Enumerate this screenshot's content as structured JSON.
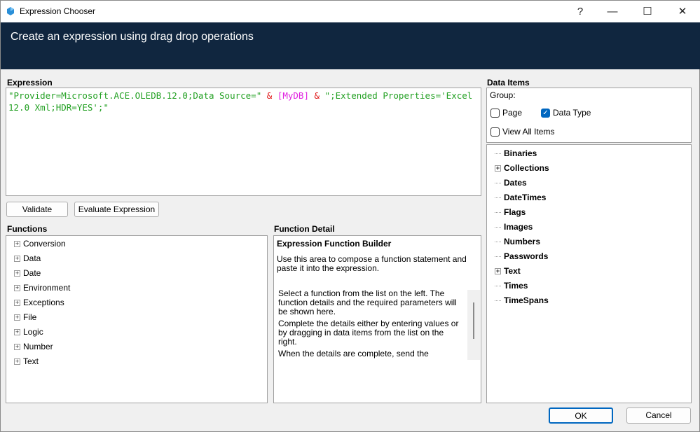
{
  "window": {
    "title": "Expression Chooser",
    "help": "?",
    "minimize": "—",
    "maximize": "☐",
    "close": "✕"
  },
  "header": {
    "title": "Create an expression using drag drop operations"
  },
  "expression": {
    "label": "Expression",
    "part1": "\"Provider=Microsoft.ACE.OLEDB.12.0;Data Source=\" ",
    "op1": "&",
    "var": "[MyDB]",
    "op2": "&",
    "part2": " \";Extended Properties='Excel 12.0 Xml;HDR=YES';\""
  },
  "buttons": {
    "validate": "Validate",
    "evaluate": "Evaluate Expression",
    "ok": "OK",
    "cancel": "Cancel"
  },
  "functions": {
    "label": "Functions",
    "items": [
      "Conversion",
      "Data",
      "Date",
      "Environment",
      "Exceptions",
      "File",
      "Logic",
      "Number",
      "Text"
    ]
  },
  "function_detail": {
    "label": "Function Detail",
    "title": "Expression Function Builder",
    "intro": "Use this area to compose a function statement and paste it into the expression.",
    "p1": "Select a function from the list on the left. The function details and the required parameters will be shown here.",
    "p2": "Complete the details either by entering values or by dragging in data items from the list on the right.",
    "p3": "When the details are complete, send the"
  },
  "data_items": {
    "label": "Data Items",
    "group_label": "Group:",
    "page": "Page",
    "page_checked": false,
    "data_type": "Data Type",
    "data_type_checked": true,
    "view_all": "View All Items",
    "view_all_checked": false,
    "items": [
      {
        "label": "Binaries",
        "expandable": false
      },
      {
        "label": "Collections",
        "expandable": true
      },
      {
        "label": "Dates",
        "expandable": false
      },
      {
        "label": "DateTimes",
        "expandable": false
      },
      {
        "label": "Flags",
        "expandable": false
      },
      {
        "label": "Images",
        "expandable": false
      },
      {
        "label": "Numbers",
        "expandable": false
      },
      {
        "label": "Passwords",
        "expandable": false
      },
      {
        "label": "Text",
        "expandable": true
      },
      {
        "label": "Times",
        "expandable": false
      },
      {
        "label": "TimeSpans",
        "expandable": false
      }
    ]
  }
}
